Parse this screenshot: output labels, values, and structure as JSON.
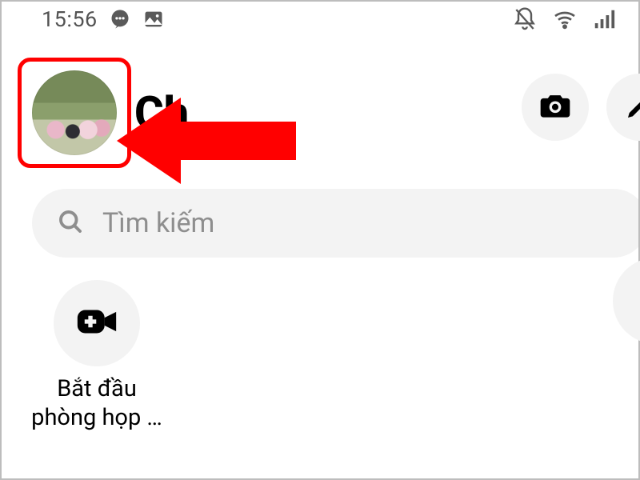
{
  "statusbar": {
    "time": "15:56",
    "icons_left": [
      "chat-bubble-icon",
      "image-icon"
    ],
    "icons_right": [
      "bell-muted-icon",
      "wifi-icon",
      "signal-icon"
    ]
  },
  "header": {
    "title_visible_fragment": "Ch",
    "avatar_alt": "profile-photo-group"
  },
  "actions": {
    "camera": "camera",
    "compose": "compose"
  },
  "search": {
    "placeholder": "Tìm kiếm"
  },
  "room": {
    "label_line1": "Bắt đầu",
    "label_line2": "phòng họp …"
  },
  "annotation": {
    "type": "red-arrow-highlight",
    "target": "profile-avatar"
  }
}
